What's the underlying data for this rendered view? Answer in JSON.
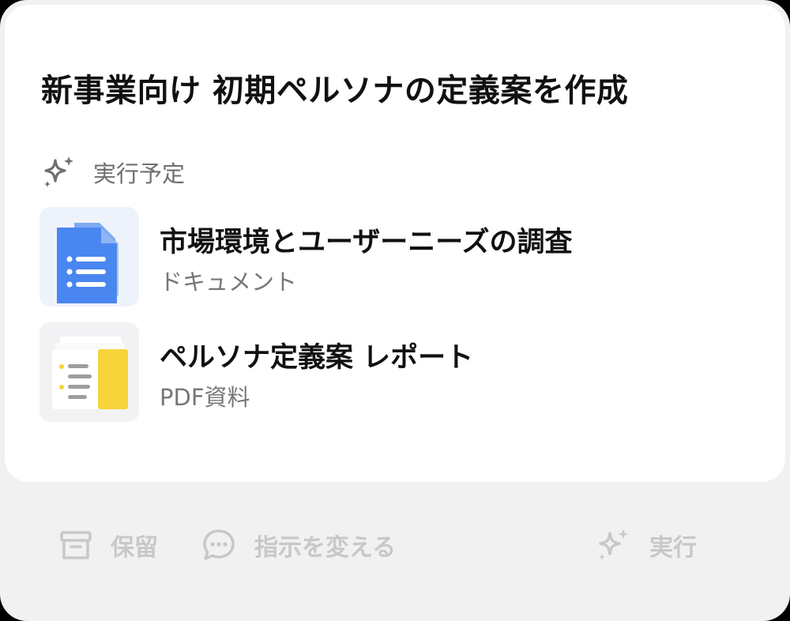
{
  "card": {
    "title": "新事業向け 初期ペルソナの定義案を作成",
    "section_label": "実行予定",
    "items": [
      {
        "title": "市場環境とユーザーニーズの調査",
        "subtitle": "ドキュメント",
        "icon": "document-icon"
      },
      {
        "title": "ペルソナ定義案 レポート",
        "subtitle": "PDF資料",
        "icon": "pdf-report-icon"
      }
    ]
  },
  "footer": {
    "hold_label": "保留",
    "change_label": "指示を変える",
    "run_label": "実行"
  },
  "colors": {
    "accent_blue": "#4a86f0",
    "accent_yellow": "#f6d43a",
    "disabled": "#c8c8ca"
  }
}
